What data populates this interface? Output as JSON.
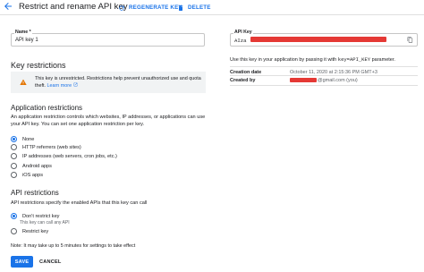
{
  "header": {
    "title": "Restrict and rename API key",
    "regenerate_label": "REGENERATE KEY",
    "delete_label": "DELETE"
  },
  "name_field": {
    "label": "Name *",
    "value": "API key 1"
  },
  "key_restrictions": {
    "heading": "Key restrictions",
    "warning_text": "This key is unrestricted. Restrictions help prevent unauthorized use and quota theft.",
    "warning_link": "Learn more"
  },
  "application_restrictions": {
    "heading": "Application restrictions",
    "description": "An application restriction controls which websites, IP addresses, or applications can use your API key. You can set one application restriction per key.",
    "options": [
      "None",
      "HTTP referrers (web sites)",
      "IP addresses (web servers, cron jobs, etc.)",
      "Android apps",
      "iOS apps"
    ],
    "selected": "None"
  },
  "api_restrictions": {
    "heading": "API restrictions",
    "description": "API restrictions specify the enabled APIs that this key can call",
    "options": [
      "Don't restrict key",
      "Restrict key"
    ],
    "sub_option_text": "This key can call any API",
    "selected": "Don't restrict key"
  },
  "note": "Note: It may take up to 5 minutes for settings to take effect",
  "actions": {
    "save_label": "SAVE",
    "cancel_label": "CANCEL"
  },
  "api_key_panel": {
    "label": "API Key",
    "value_prefix": "AIza",
    "usage_prefix": "Use this key in your application by passing it with",
    "usage_code": "key=API_KEY",
    "usage_suffix": "parameter.",
    "creation_date_label": "Creation date",
    "creation_date_value": "October 11, 2020 at 2:15:36 PM GMT+3",
    "created_by_label": "Created by",
    "created_by_suffix": "@gmail.com (you)"
  },
  "colors": {
    "accent": "#1a73e8",
    "warning": "#e37400",
    "redaction": "#e53935"
  }
}
